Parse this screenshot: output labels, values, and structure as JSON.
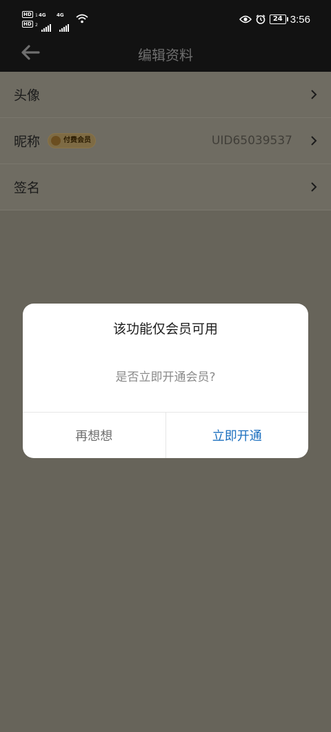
{
  "status_bar": {
    "hd1": "HD",
    "hd1_digit": "1",
    "hd2": "HD",
    "hd2_digit": "2",
    "net1": "4G",
    "net2": "4G",
    "battery": "24",
    "time": "3:56"
  },
  "toolbar": {
    "title": "编辑资料"
  },
  "profile": {
    "rows": [
      {
        "label": "头像"
      },
      {
        "label": "昵称",
        "badge": "付费会员",
        "value": "UID65039537"
      },
      {
        "label": "签名"
      }
    ]
  },
  "dialog": {
    "title": "该功能仅会员可用",
    "message": "是否立即开通会员?",
    "cancel_label": "再想想",
    "confirm_label": "立即开通"
  },
  "colors": {
    "overlay": "#67645a",
    "accent_blue": "#1b6fbf",
    "badge_gold": "#8a7448"
  }
}
